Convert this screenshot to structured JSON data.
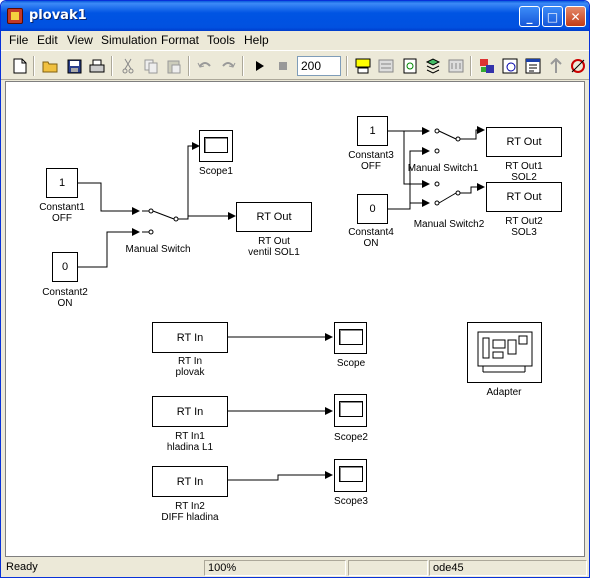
{
  "window": {
    "title": "plovak1"
  },
  "menu": [
    "File",
    "Edit",
    "View",
    "Simulation",
    "Format",
    "Tools",
    "Help"
  ],
  "toolbar": {
    "stop_time": "200",
    "icons": [
      "new-icon",
      "open-icon",
      "save-icon",
      "print-icon",
      "cut-icon",
      "copy-icon",
      "paste-icon",
      "undo-icon",
      "redo-icon",
      "start-icon",
      "stop-icon",
      "build-icon",
      "connect-icon",
      "update-icon",
      "library-icon",
      "debug-icon",
      "model-explorer-icon",
      "browser-icon",
      "properties-icon",
      "parent-icon",
      "target-icon"
    ]
  },
  "blocks": {
    "constant1": {
      "value": "1",
      "label1": "Constant1",
      "label2": "OFF"
    },
    "constant2": {
      "value": "0",
      "label1": "Constant2",
      "label2": "ON"
    },
    "constant3": {
      "value": "1",
      "label1": "Constant3",
      "label2": "OFF"
    },
    "constant4": {
      "value": "0",
      "label1": "Constant4",
      "label2": "ON"
    },
    "manual_switch": {
      "label": "Manual Switch"
    },
    "manual_switch1": {
      "label": "Manual Switch1"
    },
    "manual_switch2": {
      "label": "Manual Switch2"
    },
    "scope1": {
      "label": "Scope1"
    },
    "rt_out": {
      "text": "RT Out",
      "label1": "RT Out",
      "label2": "ventil SOL1"
    },
    "rt_out1": {
      "text": "RT Out",
      "label1": "RT Out1",
      "label2": "SOL2"
    },
    "rt_out2": {
      "text": "RT Out",
      "label1": "RT Out2",
      "label2": "SOL3"
    },
    "rt_in": {
      "text": "RT In",
      "label1": "RT In",
      "label2": "plovak"
    },
    "rt_in1": {
      "text": "RT In",
      "label1": "RT In1",
      "label2": "hladina L1"
    },
    "rt_in2": {
      "text": "RT In",
      "label1": "RT In2",
      "label2": "DIFF hladina"
    },
    "scope": {
      "label": "Scope"
    },
    "scope2": {
      "label": "Scope2"
    },
    "scope3": {
      "label": "Scope3"
    },
    "adapter": {
      "label": "Adapter"
    }
  },
  "status": {
    "state": "Ready",
    "zoom": "100%",
    "solver": "ode45"
  },
  "colors": {
    "titlebar": "#0054e3",
    "canvas": "#ffffff",
    "chrome": "#ece9d8"
  }
}
